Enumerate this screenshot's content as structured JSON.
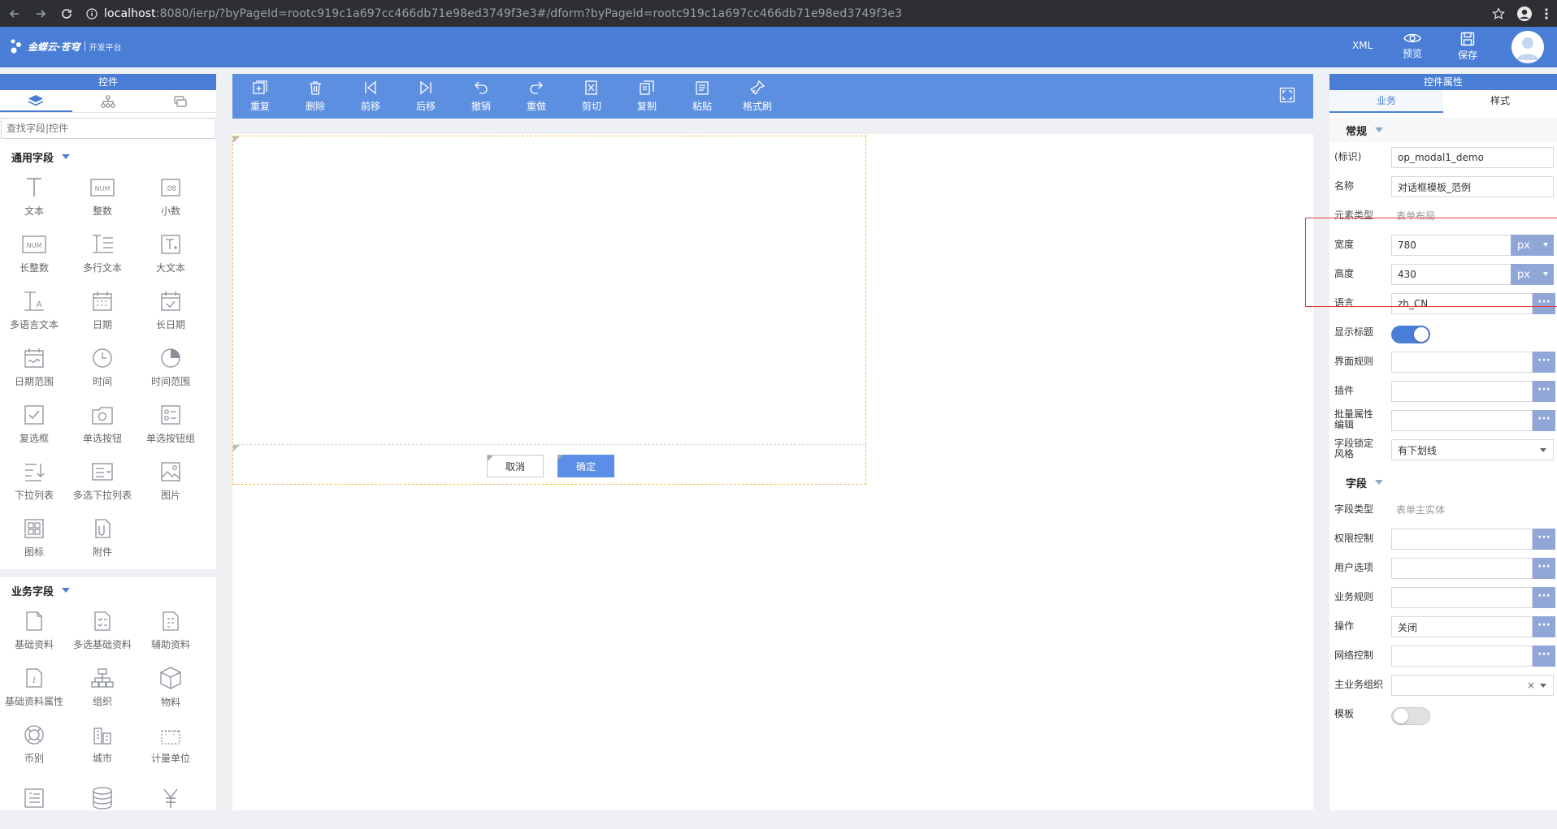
{
  "browser": {
    "url_host": "localhost",
    "url_rest": ":8080/ierp/?byPageId=rootc919c1a697cc466db71e98ed3749f3e3#/dform?byPageId=rootc919c1a697cc466db71e98ed3749f3e3"
  },
  "header": {
    "logo_text": "金蝶云·苍穹",
    "logo_sub": "开发平台",
    "xml_label": "XML",
    "preview_label": "预览",
    "save_label": "保存"
  },
  "left": {
    "title": "控件",
    "search_placeholder": "查找字段|控件",
    "common_section": "通用字段",
    "common_items": [
      "文本",
      "整数",
      "小数",
      "长整数",
      "多行文本",
      "大文本",
      "多语言文本",
      "日期",
      "长日期",
      "日期范围",
      "时间",
      "时间范围",
      "复选框",
      "单选按钮",
      "单选按钮组",
      "下拉列表",
      "多选下拉列表",
      "图片",
      "图标",
      "附件"
    ],
    "business_section": "业务字段",
    "business_items": [
      "基础资料",
      "多选基础资料",
      "辅助资料",
      "基础资料属性",
      "组织",
      "物料",
      "币别",
      "城市",
      "计量单位",
      "",
      "",
      ""
    ]
  },
  "toolbar": {
    "items": [
      "重复",
      "删除",
      "前移",
      "后移",
      "撤销",
      "重做",
      "剪切",
      "复制",
      "粘贴",
      "格式刷"
    ]
  },
  "form": {
    "cancel_label": "取消",
    "ok_label": "确定"
  },
  "right": {
    "title": "控件属性",
    "tab_business": "业务",
    "tab_style": "样式",
    "section_general": "常规",
    "id_label": "(标识)",
    "id_value": "op_modal1_demo",
    "name_label": "名称",
    "name_value": "对话框模板_范例",
    "elemtype_label": "元素类型",
    "elemtype_value": "表单布局",
    "width_label": "宽度",
    "width_value": "780",
    "height_label": "高度",
    "height_value": "430",
    "unit": "px",
    "lang_label": "语言",
    "lang_value": "zh_CN",
    "showtitle_label": "显示标题",
    "showtitle_on": true,
    "uirule_label": "界面规则",
    "plugin_label": "插件",
    "batch_label": "批量属性编辑",
    "lockstyle_label": "字段锁定风格",
    "lockstyle_value": "有下划线",
    "section_field": "字段",
    "fieldtype_label": "字段类型",
    "fieldtype_value": "表单主实体",
    "perm_label": "权限控制",
    "useropt_label": "用户选项",
    "bizrule_label": "业务规则",
    "op_label": "操作",
    "op_value": "关闭",
    "netctrl_label": "网络控制",
    "mainorg_label": "主业务组织",
    "mainorg_clear": "×",
    "template_label": "模板",
    "template_on": false,
    "dots": "···",
    "accent": "#4a7ed6"
  }
}
